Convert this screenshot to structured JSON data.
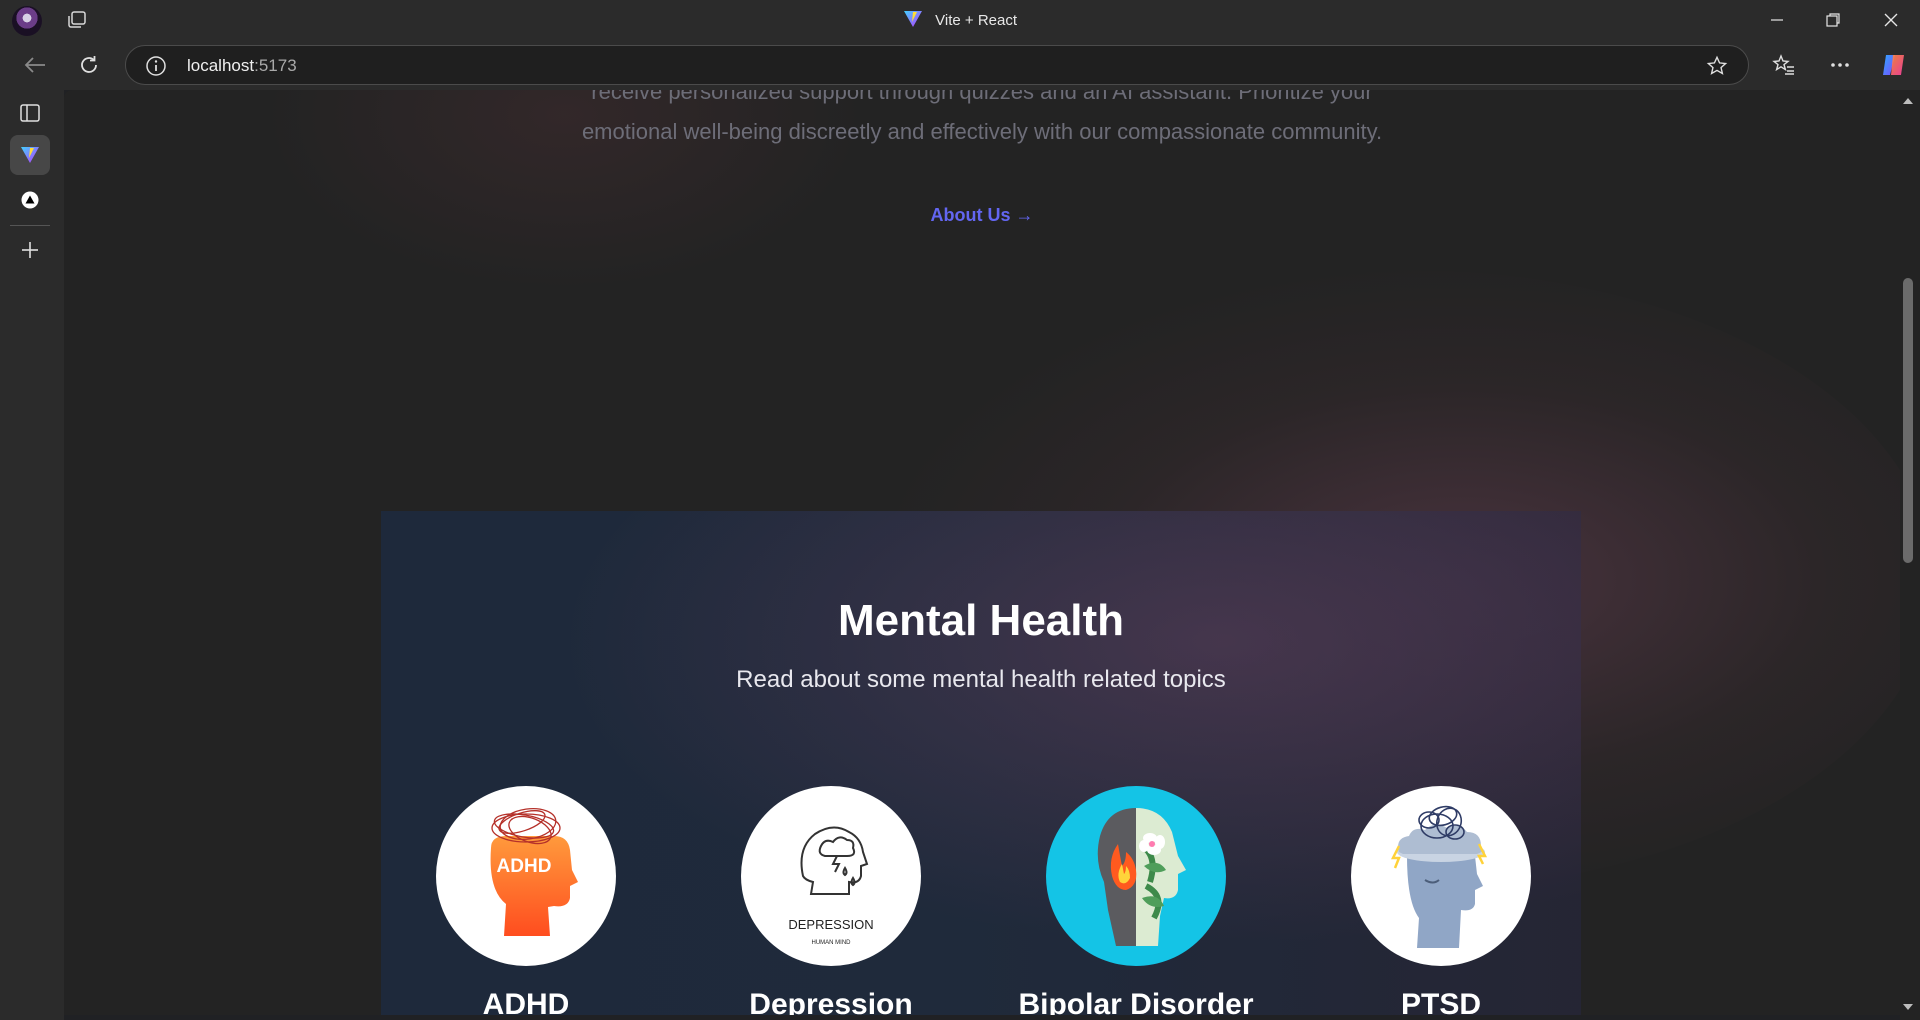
{
  "window": {
    "title": "Vite + React"
  },
  "address_bar": {
    "host": "localhost",
    "port": ":5173"
  },
  "hero": {
    "line1": "receive personalized support through quizzes and an AI assistant. Prioritize your",
    "line2": "emotional well-being discreetly and effectively with our compassionate community.",
    "about_link": "About Us →"
  },
  "mental_health": {
    "title": "Mental Health",
    "subtitle": "Read about some mental health related topics",
    "topics": [
      {
        "name": "ADHD",
        "icon": "adhd-head-icon",
        "badge": "ADHD"
      },
      {
        "name": "Depression",
        "icon": "depression-head-icon",
        "caption": "DEPRESSION",
        "subcaption": "HUMAN MIND"
      },
      {
        "name": "Bipolar Disorder",
        "icon": "bipolar-head-icon"
      },
      {
        "name": "PTSD",
        "icon": "ptsd-head-icon"
      }
    ]
  },
  "colors": {
    "accent_link": "#6366f1",
    "section_bg": "#1e293b",
    "browser_chrome": "#2b2b2b"
  }
}
